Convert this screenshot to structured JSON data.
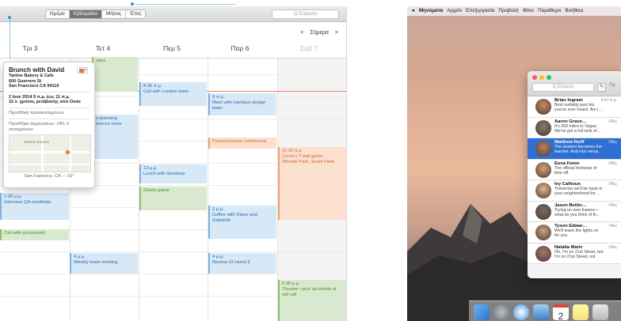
{
  "calendar": {
    "view_tabs": [
      "Ημέρα",
      "Εβδομάδα",
      "Μήνας",
      "Έτος"
    ],
    "active_tab_index": 1,
    "search_placeholder": "Q Εύρεση",
    "nav": {
      "prev": "<",
      "today": "Σήμερα",
      "next": ">"
    },
    "days": [
      "Τρι 3",
      "Τετ 4",
      "Πεμ 5",
      "Παρ 6",
      "Σαβ 7"
    ],
    "events": {
      "e1": {
        "time": "",
        "title": "tales"
      },
      "e2": {
        "time": "8:30 π.μ.",
        "title": "Call with London team"
      },
      "e3": {
        "time": "9 π.μ.",
        "title": "Meet with interface design team"
      },
      "e4": {
        "time": "",
        "title": "n planning\nerence room"
      },
      "e5": {
        "time": "",
        "title": "Parent-teacher conference"
      },
      "e6": {
        "time": "11:30 π.μ.",
        "title": "Conor's T-ball game",
        "sub": "Mitchell Park, South Field"
      },
      "e7": {
        "time": "12 μ.μ.",
        "title": "Lunch with Sendeep"
      },
      "e8": {
        "time": "",
        "title": "Giants game"
      },
      "e9": {
        "time": "1:30 μ.μ.",
        "title": "Interview QA candidate"
      },
      "e10": {
        "time": "2 μ.μ.",
        "title": "Coffee with Diane and",
        "sub": "Gabrielle"
      },
      "e11": {
        "time": "",
        "title": "Call with accountant"
      },
      "e12": {
        "time": "4 μ.μ.",
        "title": "Weekly team meeting"
      },
      "e13": {
        "time": "4 μ.μ.",
        "title": "Review UI round 2"
      },
      "e14": {
        "time": "5:30 μ.μ.",
        "title": "Theater—pick up tickets at",
        "sub": "will call"
      }
    },
    "popover": {
      "title": "Brunch with David",
      "place": "Tartine Bakery & Cafe",
      "street": "600 Guerrero St",
      "city": "San Francisco CA 94110",
      "date": "2 Ιουν 2014  9 π.μ. έως 11 π.μ.",
      "travel": "15 λ. χρόνος μετάβασης από Οικία",
      "add_invitees": "Προσθήκη προσκεκλημένων",
      "add_notes": "Προσθήκη σημειώσεων, URL ή συνημμένων",
      "map_label": "Mission Dolores",
      "map_caption": "San Francisco, CA — 15°",
      "color": "#f0732d"
    }
  },
  "desktop": {
    "menubar": [
      "Μηνύματα",
      "Αρχείο",
      "Επεξεργασία",
      "Προβολή",
      "Φίλοι",
      "Παράθυρο",
      "Βοήθεια"
    ],
    "messages": {
      "search_placeholder": "Q Εύρεση",
      "compose_icon": "compose-icon",
      "partial_label": "Πρ",
      "conversations": [
        {
          "name": "Brian Ingram",
          "time": "9:41 π.μ.",
          "line1": "Best surfably jazz trio",
          "line2": "you've ever heard. Am I…"
        },
        {
          "name": "Aaron Grave…",
          "time": "Χθες",
          "line1": "It's 269 miles to Vegas.",
          "line2": "We've got a full tank of…"
        },
        {
          "name": "Matthew Reiff",
          "time": "Χθες",
          "line1": "The student becomes the",
          "line2": "teacher. And vice versa."
        },
        {
          "name": "Euna Kwon",
          "time": "Χθες",
          "line1": "The official footwear of",
          "line2": "time off."
        },
        {
          "name": "Ivy Calhoun",
          "time": "Χθες",
          "line1": "Tomorrow we'll be back in",
          "line2": "your neighborhood for…"
        },
        {
          "name": "Jason Bettin…",
          "time": "Χθες",
          "line1": "Trying on new frames—",
          "line2": "what do you think of th…"
        },
        {
          "name": "Tyson Edwar…",
          "time": "Χθες",
          "line1": "We'll leave the lights on",
          "line2": "for you."
        },
        {
          "name": "Natalia Maric",
          "time": "Χθες",
          "line1": "Oh, I'm on 21st Street, but",
          "line2": "I'm on 21st Street, not"
        }
      ],
      "selected_index": 2
    },
    "dock_icons": [
      "finder-icon",
      "launchpad-icon",
      "safari-icon",
      "photo-icon",
      "calendar-icon",
      "notes-icon",
      "app-icon"
    ],
    "dock_calendar_day": "2"
  }
}
